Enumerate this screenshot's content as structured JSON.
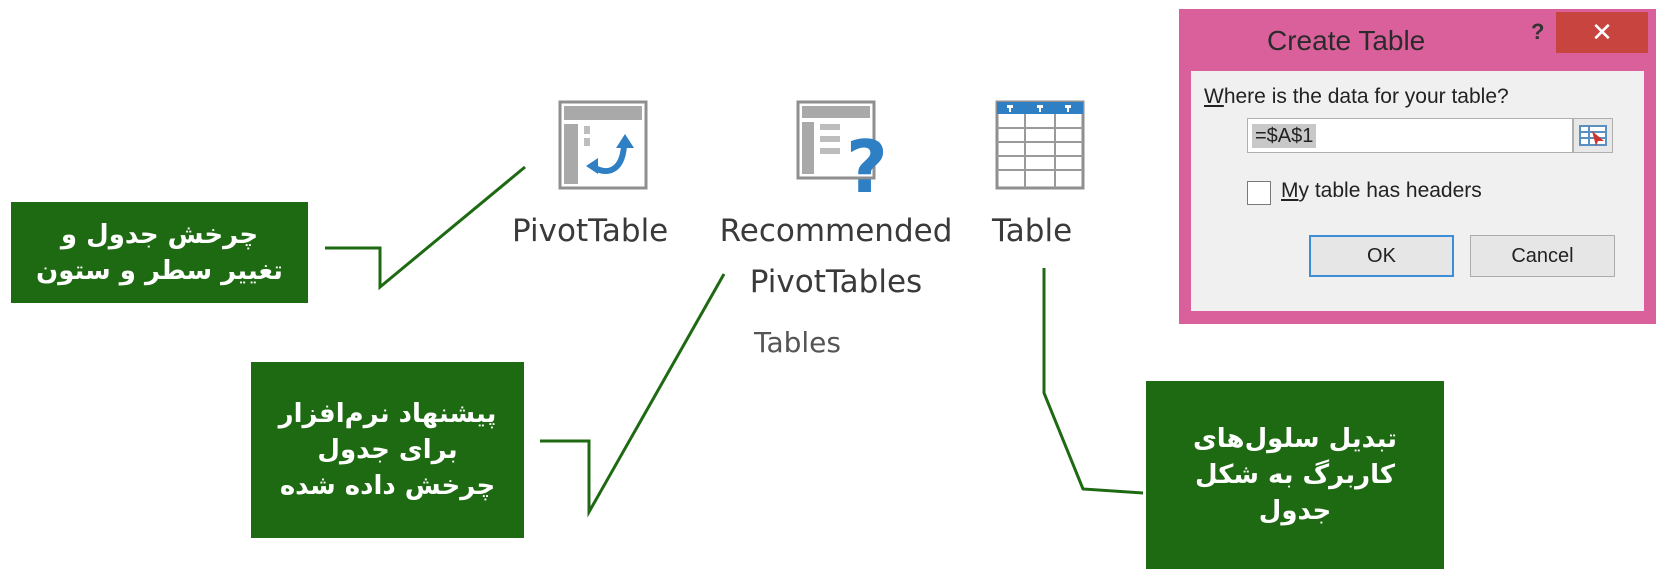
{
  "ribbon": {
    "pivot_label": "PivotTable",
    "recommended_label_line1": "Recommended",
    "recommended_label_line2": "PivotTables",
    "table_label": "Table",
    "group_label": "Tables"
  },
  "callouts": {
    "pivot_line1": "چرخش جدول و",
    "pivot_line2": "تغییر سطر و ستون",
    "recommended_line1": "پیشنهاد نرم‌افزار",
    "recommended_line2": "برای جدول",
    "recommended_line3": "چرخش داده شده",
    "table_line1": "تبدیل سلول‌های",
    "table_line2": "کاربرگ به شکل",
    "table_line3": "جدول",
    "color": "#1e6a12"
  },
  "dialog": {
    "title": "Create Table",
    "help": "?",
    "close": "✕",
    "prompt_first": "W",
    "prompt_rest": "here is the data for your table?",
    "range_value": "=$A$1",
    "checkbox_first": "M",
    "checkbox_rest": "y table has headers",
    "checkbox_checked": false,
    "ok_label": "OK",
    "cancel_label": "Cancel",
    "frame_color": "#d9609a",
    "close_color": "#c8453f"
  }
}
